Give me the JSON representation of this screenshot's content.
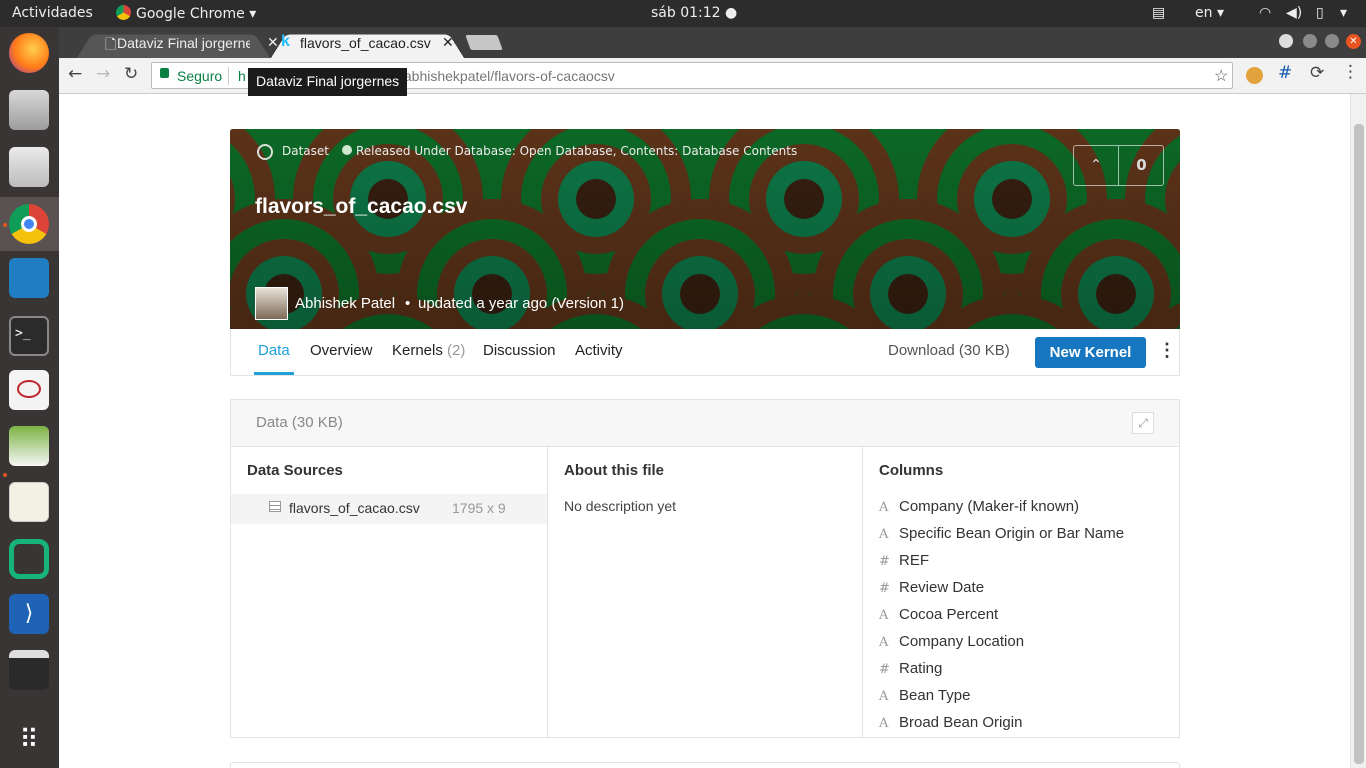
{
  "os": {
    "activities": "Actividades",
    "app_name": "Google Chrome",
    "clock": "sáb 01:12 ●",
    "language": "en"
  },
  "browser": {
    "tabs": [
      {
        "label": "Dataviz Final jorgernes"
      },
      {
        "label": "flavors_of_cacao.csv"
      }
    ],
    "secure_label": "Seguro",
    "url_start": "h",
    "url_rest": "/abhishekpatel/flavors-of-cacaocsv",
    "tooltip": "Dataviz Final jorgernes"
  },
  "dataset": {
    "type_label": "Dataset",
    "license": "Released Under Database: Open Database, Contents: Database Contents",
    "title": "flavors_of_cacao.csv",
    "author": "Abhishek Patel",
    "updated": "updated a year ago (Version 1)",
    "votes": "0",
    "banner_colors": [
      "#0e7a2c",
      "#6b3b1c",
      "#3e2412",
      "#0f8a52"
    ]
  },
  "nav": {
    "tabs": [
      {
        "label": "Data",
        "active": true
      },
      {
        "label": "Overview"
      },
      {
        "label": "Kernels"
      },
      {
        "label": "Discussion"
      },
      {
        "label": "Activity"
      }
    ],
    "kernels_count": "(2)",
    "download": "Download (30 KB)",
    "new_kernel": "New Kernel"
  },
  "data_panel": {
    "header": "Data (30 KB)",
    "sources_title": "Data Sources",
    "file_name": "flavors_of_cacao.csv",
    "file_dims": "1795 x 9",
    "about_title": "About this file",
    "about_text": "No description yet",
    "columns_title": "Columns",
    "columns": [
      {
        "type": "A",
        "name": "Company  (Maker-if known)"
      },
      {
        "type": "A",
        "name": "Specific Bean Origin or Bar Name"
      },
      {
        "type": "#",
        "name": "REF"
      },
      {
        "type": "#",
        "name": "Review Date"
      },
      {
        "type": "A",
        "name": "Cocoa Percent"
      },
      {
        "type": "A",
        "name": "Company Location"
      },
      {
        "type": "#",
        "name": "Rating"
      },
      {
        "type": "A",
        "name": "Bean Type"
      },
      {
        "type": "A",
        "name": "Broad Bean Origin"
      }
    ]
  }
}
